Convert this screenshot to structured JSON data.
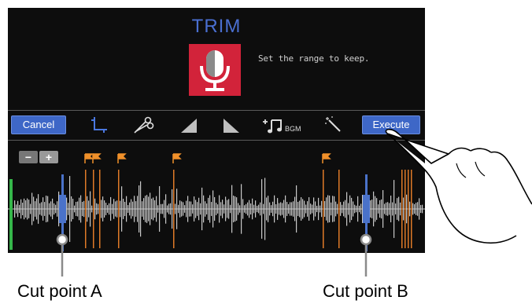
{
  "screen": {
    "title": "TRIM",
    "hint": "Set the range to keep.",
    "mic_icon": "microphone-icon",
    "accent_color": "#3e67c7",
    "mic_bg_color": "#d2233a"
  },
  "toolbar": {
    "cancel_label": "Cancel",
    "execute_label": "Execute",
    "bgm_label": "BGM",
    "icons": [
      "crop-icon",
      "scissors-icon",
      "fade-in-icon",
      "fade-out-icon",
      "add-bgm-icon",
      "magic-wand-icon"
    ]
  },
  "zoom": {
    "minus_label": "−",
    "plus_label": "+"
  },
  "markers": {
    "flag_color": "#f0902a",
    "marker_line_color": "#e07a28",
    "cut_marker_color": "#4a72c9"
  },
  "labels": {
    "cut_a": "Cut point A",
    "cut_b": "Cut point B"
  }
}
